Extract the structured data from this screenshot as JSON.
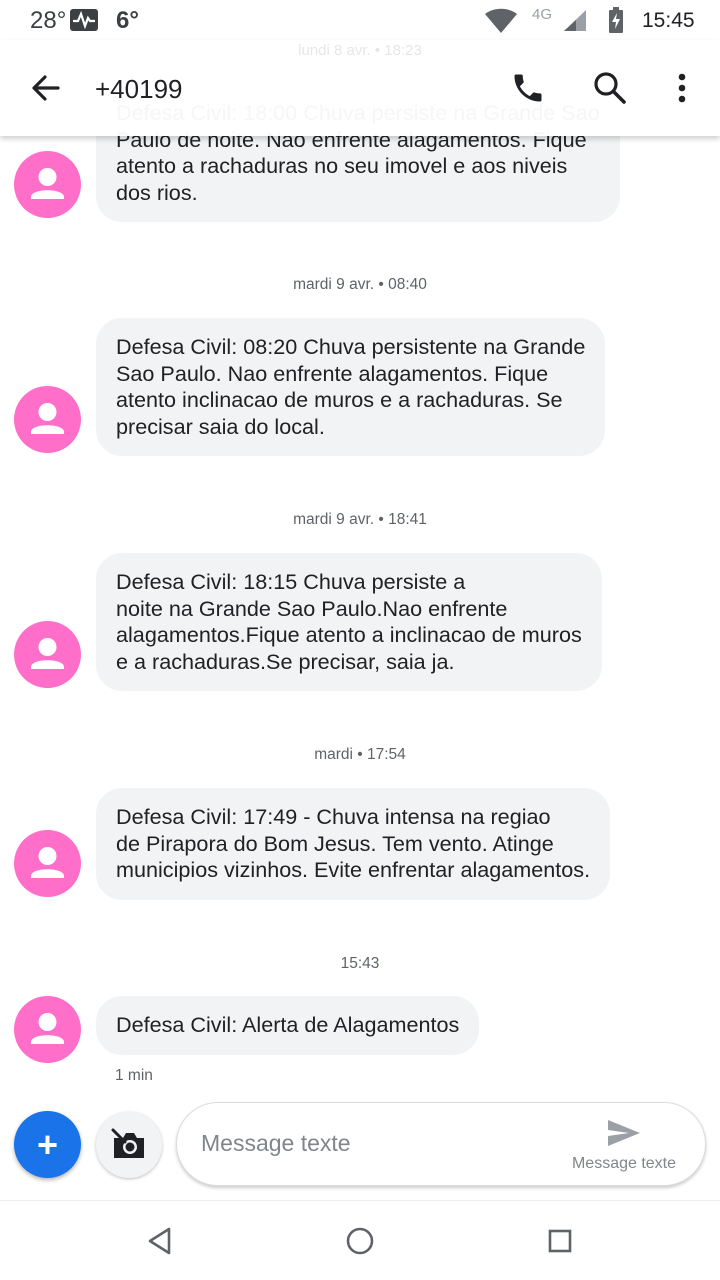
{
  "status_bar": {
    "temperature": "28°",
    "secondary_temp": "6°",
    "network": "4G",
    "time": "15:45",
    "icons": [
      "pulse-icon",
      "wifi-icon",
      "signal-icon",
      "battery-charging-icon"
    ]
  },
  "app_bar": {
    "title": "+40199",
    "icons": [
      "back-arrow-icon",
      "phone-icon",
      "search-icon",
      "more-vert-icon"
    ]
  },
  "ghost_date": "lundi 8 avr. • 18:23",
  "conversation": {
    "messages": [
      {
        "stamp": "",
        "text": "Defesa Civil: 18:00 Chuva persiste na Grande Sao\nPaulo de noite. Nao enfrente alagamentos. Fique\natento a rachaduras no seu imovel e aos niveis\ndos rios."
      },
      {
        "stamp": "mardi 9 avr. • 08:40",
        "text": "Defesa Civil: 08:20 Chuva persistente na Grande\nSao Paulo. Nao enfrente alagamentos. Fique\natento inclinacao de muros e a rachaduras. Se\nprecisar saia do local."
      },
      {
        "stamp": "mardi 9 avr. • 18:41",
        "text": "Defesa Civil: 18:15 Chuva persiste a\nnoite na Grande Sao Paulo.Nao enfrente\nalagamentos.Fique atento a inclinacao de muros\ne a rachaduras.Se precisar, saia ja."
      },
      {
        "stamp": "mardi • 17:54",
        "text": "Defesa Civil: 17:49 - Chuva intensa na regiao\nde Pirapora do Bom Jesus. Tem vento. Atinge\nmunicipios vizinhos. Evite enfrentar alagamentos."
      },
      {
        "stamp": "15:43",
        "text": "Defesa Civil: Alerta de Alagamentos",
        "age": "1 min"
      }
    ]
  },
  "compose": {
    "add_label": "+",
    "placeholder": "Message texte",
    "send_label": "Message texte",
    "icons": [
      "add-icon",
      "camera-icon",
      "send-icon"
    ]
  },
  "nav_bar": {
    "icons": [
      "nav-back-icon",
      "nav-home-icon",
      "nav-recents-icon"
    ]
  },
  "colors": {
    "avatar": "#ff6fca",
    "bubble": "#f1f3f4",
    "fab": "#1a73e8"
  }
}
